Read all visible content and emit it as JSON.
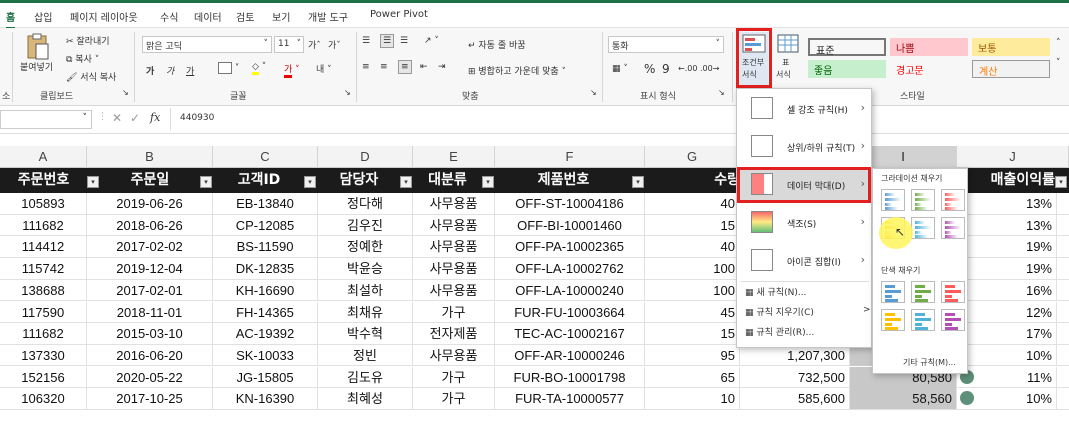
{
  "tabs": [
    "홈",
    "삽입",
    "페이지 레이아웃",
    "수식",
    "데이터",
    "검토",
    "보기",
    "개발 도구",
    "Power Pivot"
  ],
  "ribbon": {
    "clipboard": {
      "paste": "붙여넣기",
      "cut": "잘라내기",
      "copy": "복사",
      "format_painter": "서식 복사",
      "group": "클립보드",
      "left_group_fragment": "소"
    },
    "font": {
      "name": "맑은 고딕",
      "size": "11",
      "group": "글꼴",
      "grow": "가ˆ",
      "shrink": "가ˇ",
      "effects": [
        "가",
        "가",
        "가"
      ],
      "underline_icon": "가",
      "phonetic": "내천"
    },
    "alignment": {
      "wrap": "자동 줄 바꿈",
      "merge": "병합하고 가운데 맞춤",
      "group": "맞춤"
    },
    "number": {
      "format": "통화",
      "group": "표시 형식",
      "percent": "%",
      "comma": "9",
      "decimal": "←.00 .00→"
    },
    "styles": {
      "conditional": "조건부\n서식",
      "conditional_line1": "조건부",
      "conditional_line2": "서식",
      "table_line1": "표",
      "table_line2": "서식",
      "group": "스타일",
      "cells": [
        {
          "label": "표준",
          "bg": "#ffffff",
          "fg": "#222222"
        },
        {
          "label": "나쁨",
          "bg": "#ffc7ce",
          "fg": "#9c0006"
        },
        {
          "label": "보통",
          "bg": "#ffeb9c",
          "fg": "#9c5700"
        },
        {
          "label": "좋음",
          "bg": "#c6efce",
          "fg": "#006100"
        },
        {
          "label": "경고문",
          "bg": "#f7f7f7",
          "fg": "#ff0000"
        },
        {
          "label": "계산",
          "bg": "#f2f2f2",
          "fg": "#fa7d00"
        }
      ]
    }
  },
  "formula_bar": {
    "name_box": "",
    "value": "440930",
    "fx": "fx"
  },
  "columns": [
    "A",
    "B",
    "C",
    "D",
    "E",
    "F",
    "G",
    "I",
    "J"
  ],
  "headers": [
    "주문번호",
    "주문일",
    "고객ID",
    "담당자",
    "대분류",
    "제품번호",
    "수량",
    "",
    "매출이익률"
  ],
  "rows": [
    {
      "order": "105893",
      "date": "2019-06-26",
      "cust": "EB-13840",
      "rep": "정다해",
      "cat": "사무용품",
      "prod": "OFF-ST-10004186",
      "qty": "40",
      "sales": "",
      "profit": "",
      "rate": "13%"
    },
    {
      "order": "111682",
      "date": "2018-06-26",
      "cust": "CP-12085",
      "rep": "김우진",
      "cat": "사무용품",
      "prod": "OFF-BI-10001460",
      "qty": "15",
      "sales": "",
      "profit": "",
      "rate": "13%"
    },
    {
      "order": "114412",
      "date": "2017-02-02",
      "cust": "BS-11590",
      "rep": "정예한",
      "cat": "사무용품",
      "prod": "OFF-PA-10002365",
      "qty": "40",
      "sales": "",
      "profit": "",
      "rate": "19%"
    },
    {
      "order": "115742",
      "date": "2019-12-04",
      "cust": "DK-12835",
      "rep": "박윤승",
      "cat": "사무용품",
      "prod": "OFF-LA-10002762",
      "qty": "100",
      "sales": "",
      "profit": "",
      "rate": "19%"
    },
    {
      "order": "138688",
      "date": "2017-02-01",
      "cust": "KH-16690",
      "rep": "최설하",
      "cat": "사무용품",
      "prod": "OFF-LA-10000240",
      "qty": "100",
      "sales": "",
      "profit": "",
      "rate": "16%"
    },
    {
      "order": "117590",
      "date": "2018-11-01",
      "cust": "FH-14365",
      "rep": "최채유",
      "cat": "가구",
      "prod": "FUR-FU-10003664",
      "qty": "45",
      "sales": "",
      "profit": "",
      "rate": "12%"
    },
    {
      "order": "111682",
      "date": "2015-03-10",
      "cust": "AC-19392",
      "rep": "박수혁",
      "cat": "전자제품",
      "prod": "TEC-AC-10002167",
      "qty": "15",
      "sales": "",
      "profit": "",
      "rate": "17%"
    },
    {
      "order": "137330",
      "date": "2016-06-20",
      "cust": "SK-10033",
      "rep": "정빈",
      "cat": "사무용품",
      "prod": "OFF-AR-10000246",
      "qty": "95",
      "sales": "1,207,300",
      "profit": "",
      "rate": "10%"
    },
    {
      "order": "152156",
      "date": "2020-05-22",
      "cust": "JG-15805",
      "rep": "김도유",
      "cat": "가구",
      "prod": "FUR-BO-10001798",
      "qty": "65",
      "sales": "732,500",
      "profit": "80,580",
      "rate": "11%"
    },
    {
      "order": "106320",
      "date": "2017-10-25",
      "cust": "KN-16390",
      "rep": "최혜성",
      "cat": "가구",
      "prod": "FUR-TA-10000577",
      "qty": "10",
      "sales": "585,600",
      "profit": "58,560",
      "rate": "10%"
    }
  ],
  "cf_menu": {
    "items": [
      {
        "label": "셀 강조 규칙(H)",
        "has_sub": true
      },
      {
        "label": "상위/하위 규칙(T)",
        "has_sub": true
      },
      {
        "label": "데이터 막대(D)",
        "has_sub": true
      },
      {
        "label": "색조(S)",
        "has_sub": true
      },
      {
        "label": "아이콘 집합(I)",
        "has_sub": true
      }
    ],
    "small_items": [
      "새 규칙(N)...",
      "규칙 지우기(C)",
      "규칙 관리(R)..."
    ],
    "clear_arrow": ">"
  },
  "databar_menu": {
    "gradient_title": "그라데이션 채우기",
    "solid_title": "단색 채우기",
    "more": "기타 규칙(M)...",
    "colors": [
      "#5b9bd5",
      "#70ad47",
      "#ff5b5b",
      "#ffc000",
      "#4fb3d9",
      "#b44fb4"
    ]
  }
}
